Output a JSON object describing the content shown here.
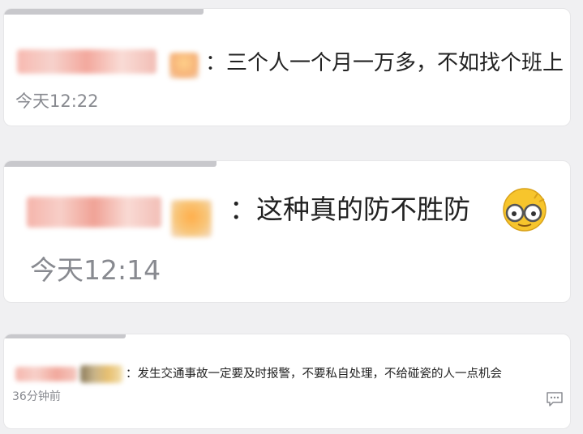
{
  "comments": [
    {
      "text": "：三个人一个月一万多，不如找个班上",
      "time": "今天12:22"
    },
    {
      "text": "：这种真的防不胜防",
      "time": "今天12:14",
      "emoji": "grimace-glasses-emoji"
    },
    {
      "text": "：发生交通事故一定要及时报警，不要私自处理，不给碰瓷的人一点机会",
      "time": "36分钟前",
      "icon": "reply-icon"
    }
  ]
}
